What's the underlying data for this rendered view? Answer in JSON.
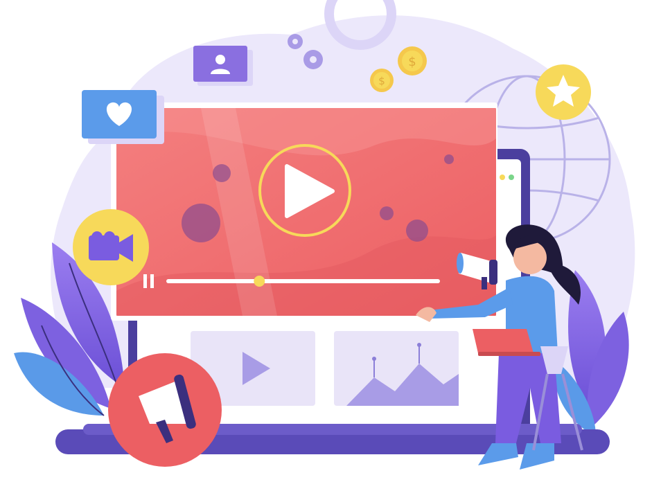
{
  "illustration": {
    "icons": [
      "play-icon",
      "pause-icon",
      "heart-icon",
      "user-icon",
      "gear-icon",
      "dollar-icon",
      "star-icon",
      "camera-icon",
      "megaphone-icon",
      "globe-icon",
      "laptop-icon",
      "chart-icon"
    ],
    "video_player": {
      "progress": 0.34
    },
    "coins": [
      "$",
      "$"
    ],
    "colors": {
      "blob": "#ebe6fb",
      "video": "#f07070",
      "accent_yellow": "#f7d95a",
      "purple": "#8a6fe0",
      "blue": "#5b9bea",
      "dark_purple": "#4b3f9e"
    }
  }
}
